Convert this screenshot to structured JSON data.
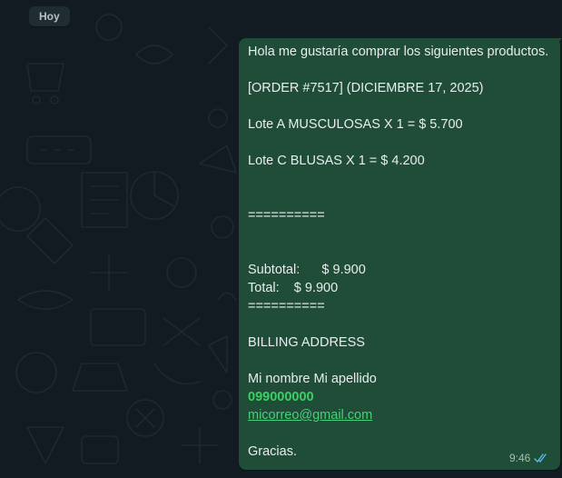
{
  "date_divider": "Hoy",
  "message": {
    "lines": {
      "greeting": "Hola me gustaría comprar los siguientes productos.",
      "order": "[ORDER #7517] (DICIEMBRE 17, 2025)",
      "item_a": "Lote A MUSCULOSAS X 1 = $ 5.700",
      "item_c": "Lote C BLUSAS X 1 = $ 4.200",
      "separator_1": "==========",
      "subtotal": "Subtotal:      $ 9.900",
      "total": "Total:    $ 9.900",
      "separator_2": "==========",
      "billing_heading": "BILLING ADDRESS",
      "name": "Mi nombre Mi apellido",
      "phone": "099000000",
      "email": "micorreo@gmail.com",
      "closing": "Gracias."
    },
    "time": "9:46",
    "status_icon": "double-check-read-icon"
  },
  "colors": {
    "chat_background": "#121b22",
    "bubble_outgoing": "#1f4d38",
    "message_text": "#e9edef",
    "phone_link": "#3ccf66",
    "email_link": "#46d17a",
    "read_ticks": "#53bdeb"
  }
}
